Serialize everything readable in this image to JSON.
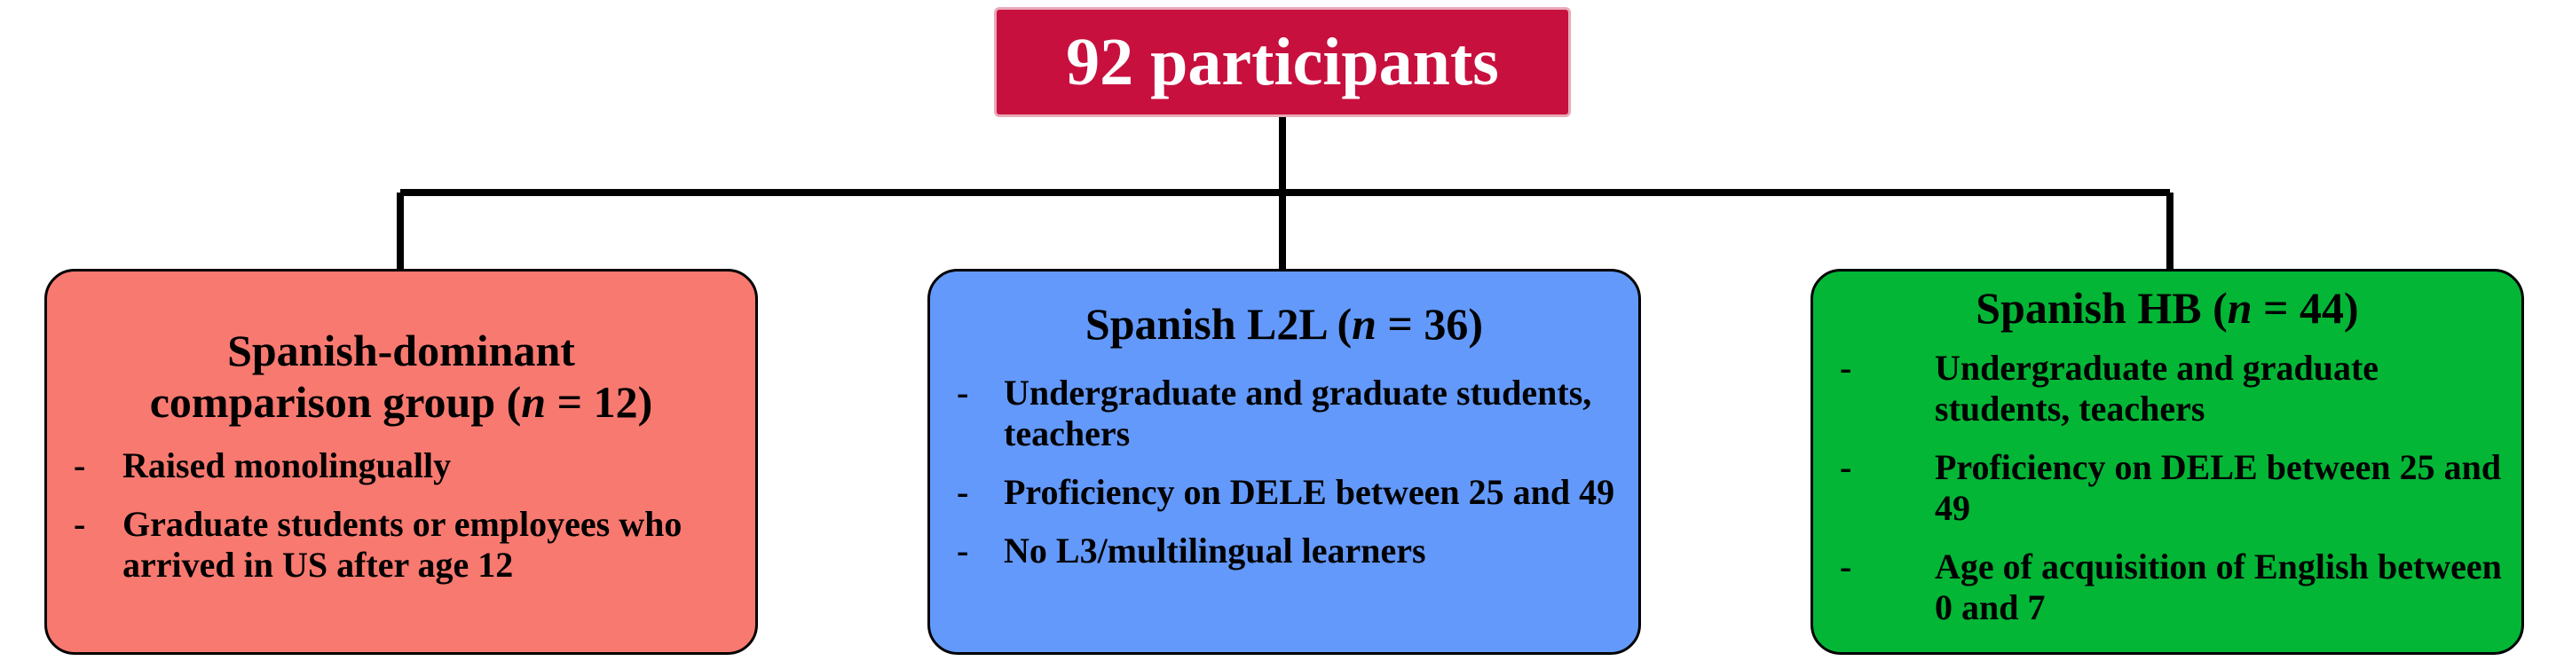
{
  "top": {
    "label": "92 participants"
  },
  "groups": [
    {
      "title_line1": "Spanish-dominant",
      "title_line2_pre": "comparison group (",
      "n_symbol": "n",
      "n_value": " = 12)",
      "items": [
        "Raised monolingually",
        "Graduate students or employees who arrived in US after age 12"
      ]
    },
    {
      "title_pre": "Spanish L2L (",
      "n_symbol": "n",
      "n_value": " = 36)",
      "items": [
        "Undergraduate and graduate students, teachers",
        "Proficiency on DELE between 25 and 49",
        "No L3/multilingual learners"
      ]
    },
    {
      "title_pre": "Spanish HB (",
      "n_symbol": "n",
      "n_value": " = 44)",
      "items": [
        "Undergraduate and graduate students, teachers",
        "Proficiency on DELE between 25 and 49",
        "Age of acquisition of English between 0 and 7"
      ]
    }
  ],
  "bullet": "-",
  "colors": {
    "top_box": "#c8103e",
    "group_1": "#f87970",
    "group_2": "#6399fa",
    "group_3": "#03b636",
    "connector": "#000000"
  }
}
